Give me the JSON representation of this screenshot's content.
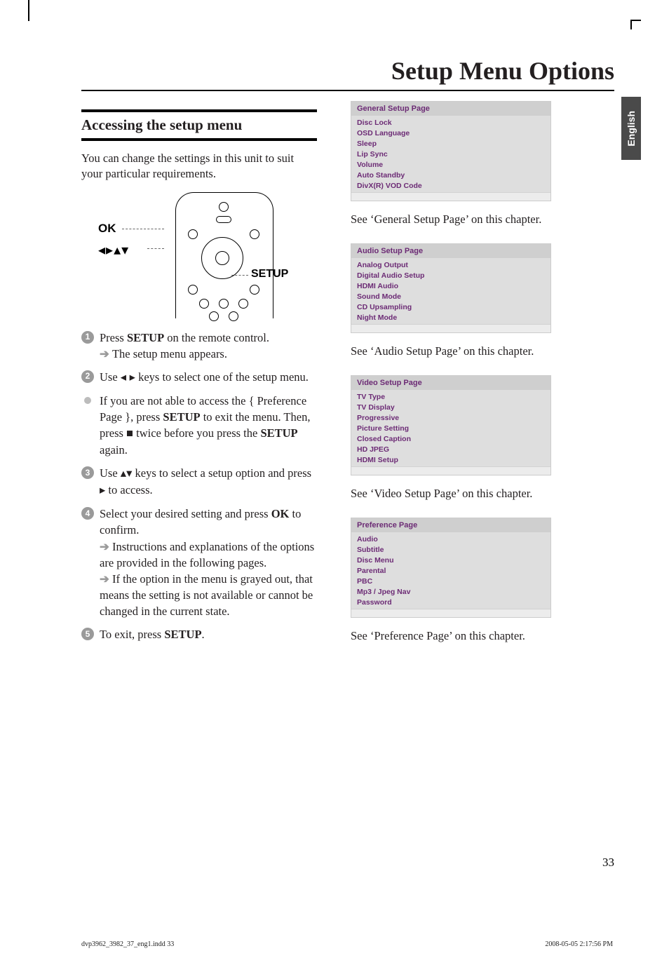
{
  "title": "Setup Menu Options",
  "language_tab": "English",
  "section_heading": "Accessing the setup menu",
  "intro": "You can change the settings in this unit to suit your particular requirements.",
  "remote_labels": {
    "ok": "OK",
    "arrows": "◂▸▴▾",
    "setup": "SETUP"
  },
  "steps": {
    "s1_a": "Press ",
    "s1_b": "SETUP",
    "s1_c": " on the remote control.",
    "s1_res": "The setup menu appears.",
    "s2_a": "Use ",
    "s2_sym": "◂ ▸",
    "s2_b": " keys to select one of the setup menu.",
    "tip_a": "If you are not able to access the { Preference Page }, press ",
    "tip_b": "SETUP",
    "tip_c": " to exit the menu. Then, press ",
    "tip_sym": "■",
    "tip_d": " twice before you press the ",
    "tip_e": "SETUP",
    "tip_f": " again.",
    "s3_a": "Use ",
    "s3_sym": "▴▾",
    "s3_b": " keys to select a setup option and press ",
    "s3_sym2": "▸",
    "s3_c": " to access.",
    "s4_a": "Select your desired setting and press ",
    "s4_b": "OK",
    "s4_c": " to confirm.",
    "s4_res1": "Instructions and explanations of the options are provided in the following pages.",
    "s4_res2": "If the option in the menu is grayed out, that means the setting is not available or cannot be changed in the current state.",
    "s5_a": "To exit, press ",
    "s5_b": "SETUP",
    "s5_c": "."
  },
  "panels": {
    "general": {
      "header": "General Setup Page",
      "items": [
        "Disc Lock",
        "OSD Language",
        "Sleep",
        "Lip Sync",
        "Volume",
        "Auto Standby",
        "DivX(R) VOD Code"
      ],
      "caption": "See ‘General Setup Page’ on this chapter."
    },
    "audio": {
      "header": "Audio Setup Page",
      "items": [
        "Analog Output",
        "Digital Audio Setup",
        "HDMI Audio",
        "Sound Mode",
        "CD Upsampling",
        "Night Mode"
      ],
      "caption": "See ‘Audio Setup Page’ on this chapter."
    },
    "video": {
      "header": "Video Setup Page",
      "items": [
        "TV Type",
        "TV Display",
        "Progressive",
        "Picture Setting",
        "Closed Caption",
        "HD JPEG",
        "HDMI Setup"
      ],
      "caption": "See ‘Video Setup Page’ on this chapter."
    },
    "preference": {
      "header": "Preference Page",
      "items": [
        "Audio",
        "Subtitle",
        "Disc Menu",
        "Parental",
        "PBC",
        "Mp3 / Jpeg Nav",
        "Password"
      ],
      "caption": "See ‘Preference Page’ on this chapter."
    }
  },
  "page_num": "33",
  "footer_left": "dvp3962_3982_37_eng1.indd   33",
  "footer_right": "2008-05-05   2:17:56 PM"
}
